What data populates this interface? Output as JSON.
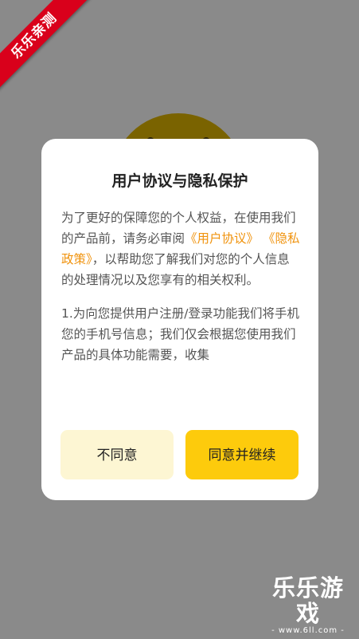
{
  "corner_ribbon": "乐乐亲测",
  "dialog": {
    "title": "用户协议与隐私保护",
    "para1": {
      "text_a": "为了更好的保障您的个人权益，在使用我们的产品前，请务必审阅",
      "link_user_agreement": "《用户协议》",
      "link_privacy_policy": "《隐私政策》",
      "text_b": "，以帮助您了解我们对您的个人信息的处理情况以及您享有的相关权利。"
    },
    "para2": "1.为向您提供用户注册/登录功能我们将手机您的手机号信息；我们仅会根据您使用我们产品的具体功能需要，收集",
    "decline_label": "不同意",
    "accept_label": "同意并继续"
  },
  "watermark": {
    "logo": "乐乐游戏",
    "url": "- www.6ll.com -"
  },
  "colors": {
    "overlay": "#8a8a8a",
    "link": "#f0930e",
    "accept_button": "#fdcb0c",
    "decline_button": "#fdf6d3",
    "ribbon": "#d9001b"
  }
}
